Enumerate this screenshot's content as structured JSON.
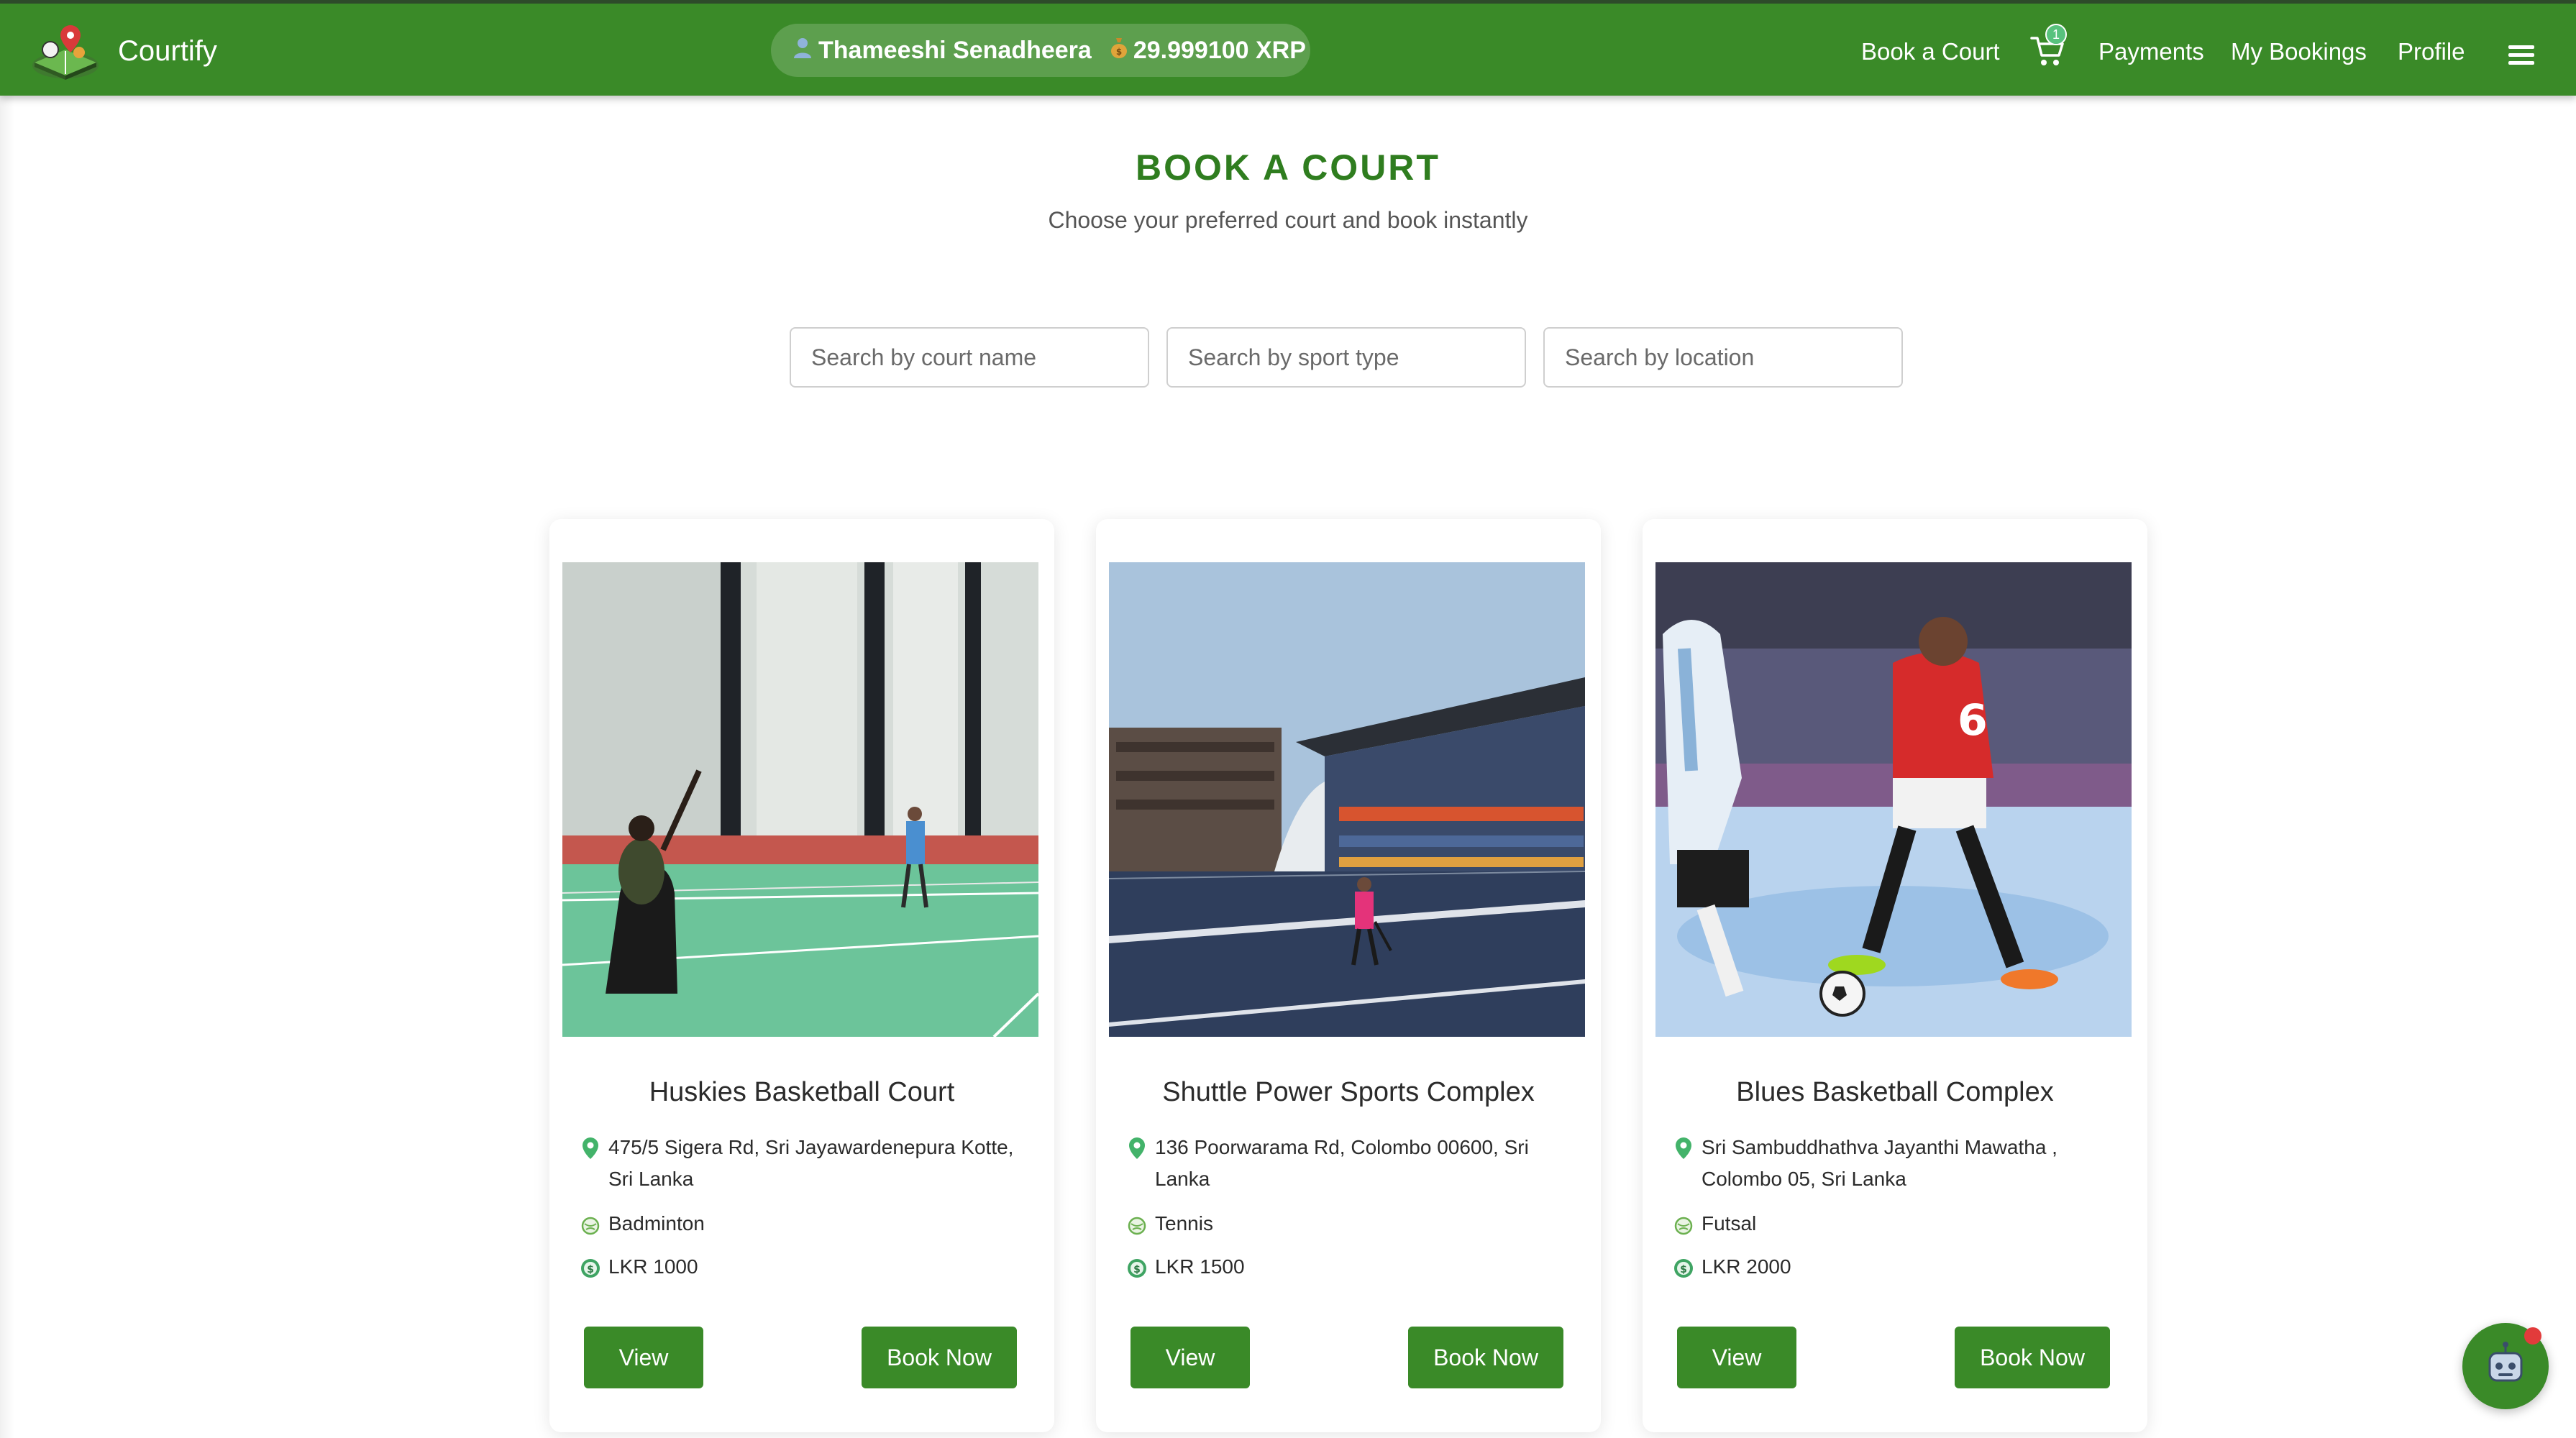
{
  "navbar": {
    "brand": "Courtify",
    "user_name": "Thameeshi Senadheera",
    "balance": "29.999100 XRP",
    "links": {
      "book_court": "Book a Court",
      "payments": "Payments",
      "my_bookings": "My Bookings",
      "profile": "Profile"
    },
    "cart_count": "1"
  },
  "header": {
    "title": "BOOK A COURT",
    "subtitle": "Choose your preferred court and book instantly"
  },
  "search": {
    "court_name_placeholder": "Search by court name",
    "sport_type_placeholder": "Search by sport type",
    "location_placeholder": "Search by location"
  },
  "courts": [
    {
      "name": "Huskies Basketball Court",
      "address": "475/5 Sigera Rd, Sri Jayawardenepura Kotte, Sri Lanka",
      "sport": "Badminton",
      "price": "LKR 1000",
      "view_label": "View",
      "book_label": "Book Now"
    },
    {
      "name": "Shuttle Power Sports Complex",
      "address": "136 Poorwarama Rd, Colombo 00600, Sri Lanka",
      "sport": "Tennis",
      "price": "LKR 1500",
      "view_label": "View",
      "book_label": "Book Now"
    },
    {
      "name": "Blues Basketball Complex",
      "address": "Sri Sambuddhathva Jayanthi Mawatha , Colombo 05, Sri Lanka",
      "sport": "Futsal",
      "price": "LKR 2000",
      "view_label": "View",
      "book_label": "Book Now"
    }
  ],
  "colors": {
    "primary": "#3a8a28",
    "title": "#2f7d1f",
    "navbar_border": "#2d4a2a"
  },
  "icons": {
    "user": "user-icon",
    "money": "money-bag-icon",
    "cart": "cart-icon",
    "menu": "hamburger-icon",
    "location": "location-pin-icon",
    "sport": "sport-ball-icon",
    "price": "price-coin-icon",
    "chat": "chatbot-icon"
  }
}
